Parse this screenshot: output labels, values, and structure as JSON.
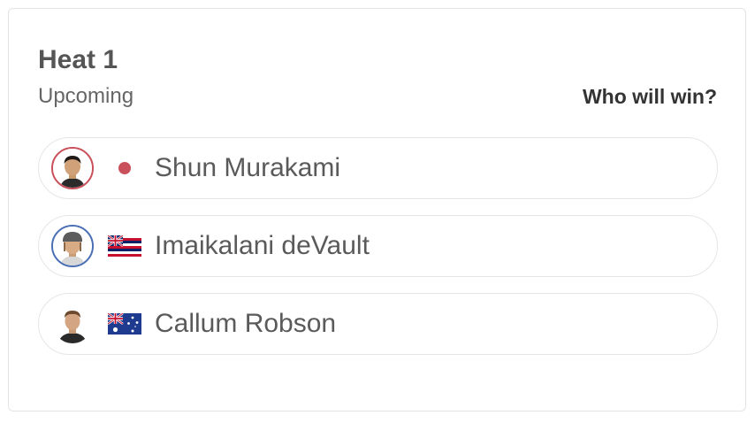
{
  "heat": {
    "title": "Heat 1",
    "status": "Upcoming",
    "prompt": "Who will win?"
  },
  "athletes": [
    {
      "name": "Shun Murakami",
      "country_flag": "japan-flag-icon",
      "avatar_ring_color": "#c9505a"
    },
    {
      "name": "Imaikalani deVault",
      "country_flag": "hawaii-flag-icon",
      "avatar_ring_color": "#4a6fb5"
    },
    {
      "name": "Callum Robson",
      "country_flag": "australia-flag-icon",
      "avatar_ring_color": "#ffffff"
    }
  ],
  "colors": {
    "japan_dot": "#c9505a",
    "border": "#e4e4e4",
    "text_primary": "#333333",
    "text_secondary": "#666666"
  }
}
